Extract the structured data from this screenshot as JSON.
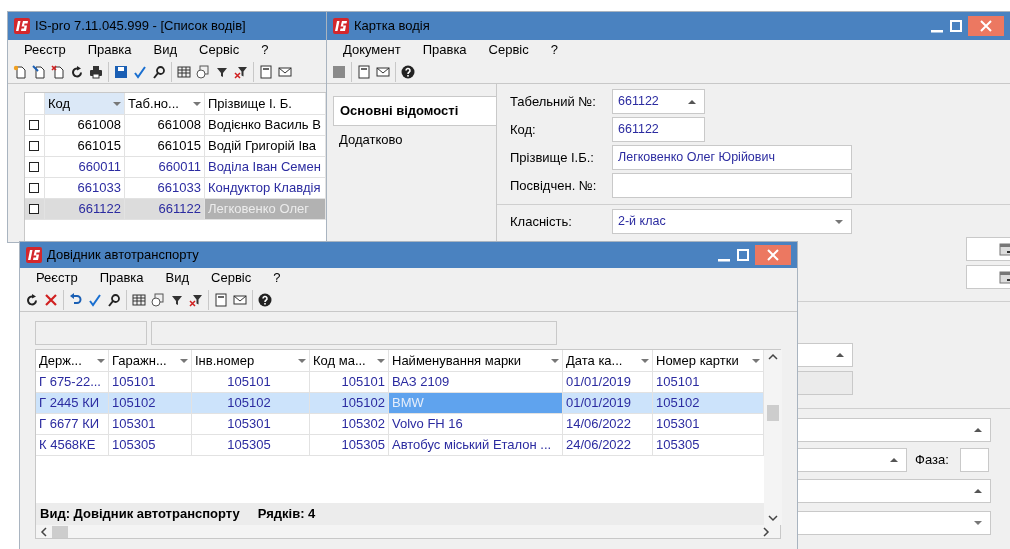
{
  "drivers_window": {
    "title": "IS-pro 7.11.045.999 - [Список водів]",
    "menu": [
      "Реєстр",
      "Правка",
      "Вид",
      "Сервіс",
      "?"
    ],
    "columns": [
      {
        "label": "Код",
        "sorted": true,
        "focused": false
      },
      {
        "label": "Таб.но...",
        "sorted": false,
        "focused": false
      },
      {
        "label": "Прізвище І. Б.",
        "sorted": false,
        "focused": true
      }
    ],
    "rows": [
      {
        "checked": false,
        "selected": false,
        "color": "#000000",
        "cells": [
          "661008",
          "661008",
          "Водієнко Василь В"
        ]
      },
      {
        "checked": false,
        "selected": false,
        "color": "#000000",
        "cells": [
          "661015",
          "661015",
          "Водій Григорій Іва"
        ]
      },
      {
        "checked": false,
        "selected": false,
        "color": "#2b2ba0",
        "cells": [
          "660011",
          "660011",
          "Воділа Іван Семен"
        ]
      },
      {
        "checked": false,
        "selected": false,
        "color": "#2b2ba0",
        "cells": [
          "661033",
          "661033",
          "Кондуктор Клавдія"
        ]
      },
      {
        "checked": false,
        "selected": true,
        "color": "#2b2ba0",
        "cells": [
          "661122",
          "661122",
          "Легковенко Олег"
        ]
      }
    ]
  },
  "card_window": {
    "title": "Картка водія",
    "menu": [
      "Документ",
      "Правка",
      "Сервіс",
      "?"
    ],
    "tabs": [
      {
        "label": "Основні відомості",
        "selected": true
      },
      {
        "label": "Додатково",
        "selected": false
      }
    ],
    "fields": [
      {
        "label": "Табельний №:",
        "value": "661122",
        "kind": "spin"
      },
      {
        "label": "Код:",
        "value": "661122",
        "kind": "short"
      },
      {
        "label": "Прізвище І.Б.:",
        "value": "Легковенко Олег Юрійович",
        "kind": "text"
      },
      {
        "label": "Посвідчен. №:",
        "kind": "text"
      },
      {
        "label": "Класність:",
        "value": "2-й клас",
        "kind": "dropdown"
      }
    ],
    "phase_label": "Фаза:"
  },
  "vehicles_window": {
    "title": "Довідник автотранспорту",
    "menu": [
      "Реєстр",
      "Правка",
      "Вид",
      "Сервіс",
      "?"
    ],
    "columns": [
      {
        "label": "Держ...",
        "focused": false
      },
      {
        "label": "Гаражн...",
        "focused": false
      },
      {
        "label": "Інв.номер",
        "focused": false
      },
      {
        "label": "Код ма...",
        "focused": false
      },
      {
        "label": "Найменування марки",
        "focused": true
      },
      {
        "label": "Дата ка...",
        "focused": false
      },
      {
        "label": "Номер картки",
        "focused": false
      }
    ],
    "rows": [
      {
        "selected": false,
        "cells": [
          "Г 675-22...",
          "105101",
          "105101",
          "105101",
          "ВАЗ 2109",
          "01/01/2019",
          "105101"
        ]
      },
      {
        "selected": true,
        "cells": [
          "Г 2445 КИ",
          "105102",
          "105102",
          "105102",
          "BMW",
          "01/01/2019",
          "105102"
        ]
      },
      {
        "selected": false,
        "cells": [
          "Г 6677 КИ",
          "105301",
          "105301",
          "105302",
          "Volvo FH 16",
          "14/06/2022",
          "105301"
        ]
      },
      {
        "selected": false,
        "cells": [
          "К 4568КЕ",
          "105305",
          "105305",
          "105305",
          "Автобус міський Еталон ...",
          "24/06/2022",
          "105305"
        ]
      }
    ],
    "view_label": "Вид: Довідник автотранспорту",
    "row_count": "Рядків: 4"
  }
}
